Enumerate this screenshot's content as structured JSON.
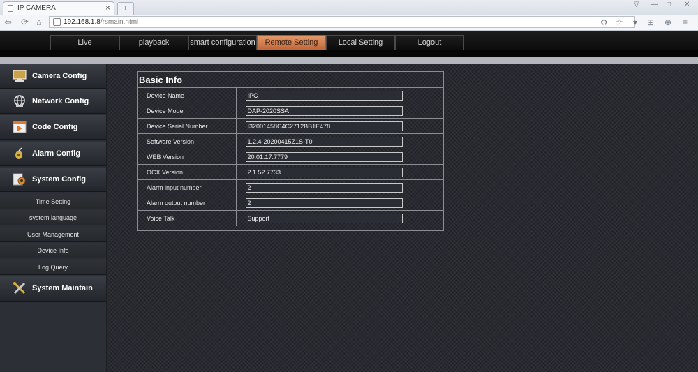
{
  "browser": {
    "tab_title": "IP CAMERA",
    "tab_close": "×",
    "new_tab": "+",
    "url_host": "192.168.1.8",
    "url_path": "/rsmain.html"
  },
  "topnav": {
    "items": [
      {
        "label": "Live"
      },
      {
        "label": "playback"
      },
      {
        "label": "smart configuration"
      },
      {
        "label": "Remote Setting"
      },
      {
        "label": "Local Setting"
      },
      {
        "label": "Logout"
      }
    ],
    "active": "Remote Setting",
    "accent_color": "#d07a48"
  },
  "sidebar": {
    "sections": [
      {
        "label": "Camera Config",
        "icon": "monitor-icon"
      },
      {
        "label": "Network Config",
        "icon": "globe-icon"
      },
      {
        "label": "Code Config",
        "icon": "video-play-icon"
      },
      {
        "label": "Alarm Config",
        "icon": "alarm-bell-icon"
      },
      {
        "label": "System Config",
        "icon": "gear-icon"
      }
    ],
    "system_items": [
      {
        "label": "Time Setting"
      },
      {
        "label": "system language"
      },
      {
        "label": "User Management"
      },
      {
        "label": "Device Info"
      },
      {
        "label": "Log Query"
      }
    ],
    "maintain": {
      "label": "System Maintain",
      "icon": "tools-icon"
    }
  },
  "basic_info": {
    "title": "Basic Info",
    "rows": [
      {
        "label": "Device Name",
        "value": "IPC"
      },
      {
        "label": "Device Model",
        "value": "DAP-2020SSA"
      },
      {
        "label": "Device Serial Number",
        "value": "I32001458C4C2712BB1E478"
      },
      {
        "label": "Software Version",
        "value": "1.2.4-20200415Z1S-T0"
      },
      {
        "label": "WEB Version",
        "value": "20.01.17.7779"
      },
      {
        "label": "OCX Version",
        "value": "2.1.52.7733"
      },
      {
        "label": "Alarm input number",
        "value": "2"
      },
      {
        "label": "Alarm output number",
        "value": "2"
      },
      {
        "label": "Voice Talk",
        "value": "Support"
      }
    ]
  }
}
